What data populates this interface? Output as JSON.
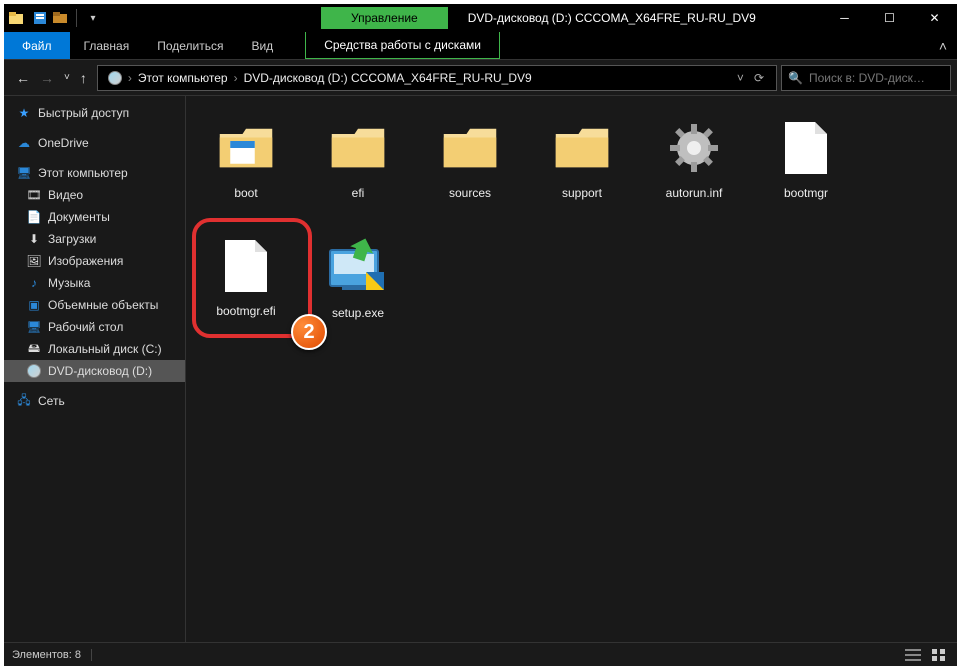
{
  "titlebar": {
    "manage_label": "Управление",
    "window_title": "DVD-дисковод (D:) CCCOMA_X64FRE_RU-RU_DV9"
  },
  "ribbon": {
    "file": "Файл",
    "home": "Главная",
    "share": "Поделиться",
    "view": "Вид",
    "drive_tools": "Средства работы с дисками"
  },
  "breadcrumb": {
    "this_pc": "Этот компьютер",
    "location": "DVD-дисковод (D:) CCCOMA_X64FRE_RU-RU_DV9"
  },
  "search": {
    "placeholder": "Поиск в: DVD-диск…"
  },
  "sidebar": {
    "quick_access": "Быстрый доступ",
    "onedrive": "OneDrive",
    "this_pc": "Этот компьютер",
    "children": [
      {
        "label": "Видео"
      },
      {
        "label": "Документы"
      },
      {
        "label": "Загрузки"
      },
      {
        "label": "Изображения"
      },
      {
        "label": "Музыка"
      },
      {
        "label": "Объемные объекты"
      },
      {
        "label": "Рабочий стол"
      },
      {
        "label": "Локальный диск (С:)"
      },
      {
        "label": "DVD-дисковод (D:)"
      }
    ],
    "network": "Сеть"
  },
  "files": [
    {
      "name": "boot",
      "type": "folder-open"
    },
    {
      "name": "efi",
      "type": "folder"
    },
    {
      "name": "sources",
      "type": "folder"
    },
    {
      "name": "support",
      "type": "folder"
    },
    {
      "name": "autorun.inf",
      "type": "gear"
    },
    {
      "name": "bootmgr",
      "type": "paper"
    },
    {
      "name": "bootmgr.efi",
      "type": "paper"
    },
    {
      "name": "setup.exe",
      "type": "setup"
    }
  ],
  "status": {
    "elements": "Элементов: 8"
  },
  "step": {
    "number": "2"
  }
}
